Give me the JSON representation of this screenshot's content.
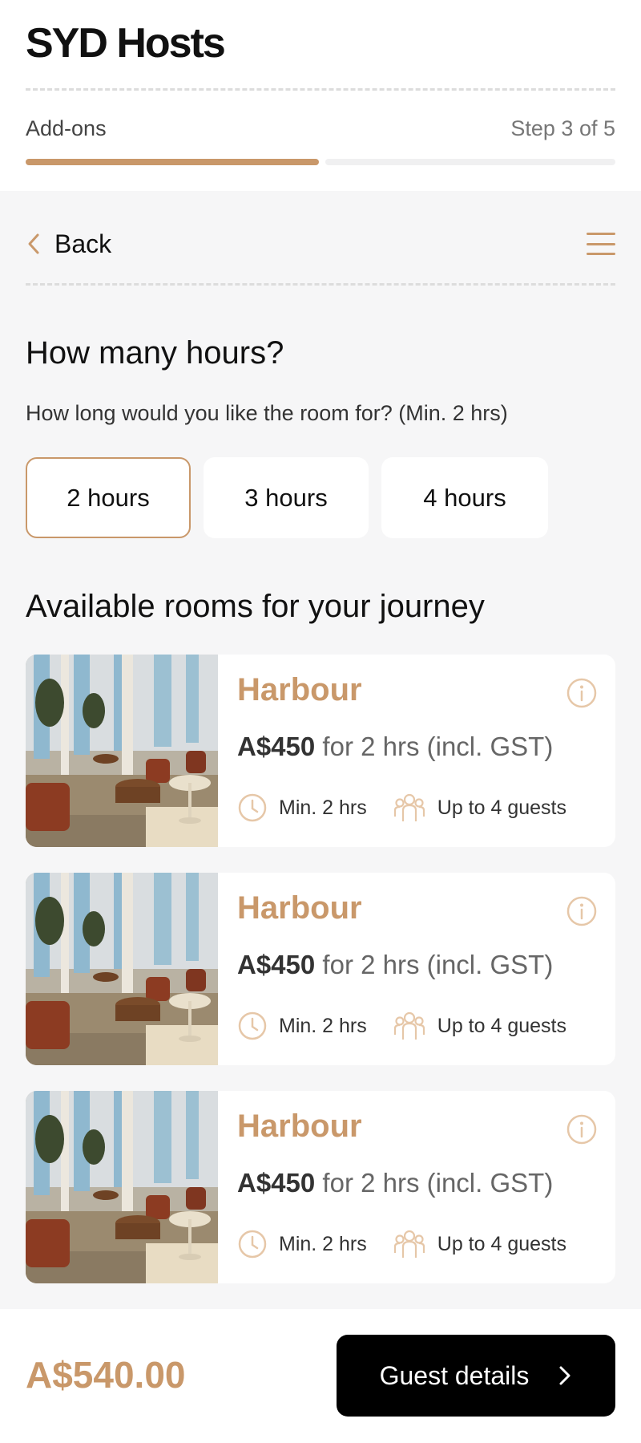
{
  "app": {
    "title": "SYD Hosts"
  },
  "progress": {
    "step_name": "Add-ons",
    "step_label": "Step 3 of 5",
    "current_step": 3,
    "total_steps": 5
  },
  "nav": {
    "back_label": "Back",
    "menu_icon": "hamburger-menu-icon"
  },
  "hours_section": {
    "title": "How many hours?",
    "subtitle": "How long would you like the room for? (Min. 2 hrs)",
    "options": [
      {
        "label": "2 hours",
        "selected": true
      },
      {
        "label": "3 hours",
        "selected": false
      },
      {
        "label": "4 hours",
        "selected": false
      }
    ]
  },
  "rooms_section": {
    "title": "Available rooms for your journey",
    "rooms": [
      {
        "name": "Harbour",
        "price": "A$450",
        "price_suffix": "for 2 hrs (incl. GST)",
        "min_hours": "Min. 2 hrs",
        "capacity": "Up to 4 guests"
      },
      {
        "name": "Harbour",
        "price": "A$450",
        "price_suffix": "for 2 hrs (incl. GST)",
        "min_hours": "Min. 2 hrs",
        "capacity": "Up to 4 guests"
      },
      {
        "name": "Harbour",
        "price": "A$450",
        "price_suffix": "for 2 hrs (incl. GST)",
        "min_hours": "Min. 2 hrs",
        "capacity": "Up to 4 guests"
      }
    ]
  },
  "footer": {
    "total": "A$540.00",
    "cta_label": "Guest details"
  },
  "colors": {
    "accent": "#c9986a",
    "background": "#f6f6f7",
    "card": "#ffffff",
    "cta_bg": "#000000"
  }
}
